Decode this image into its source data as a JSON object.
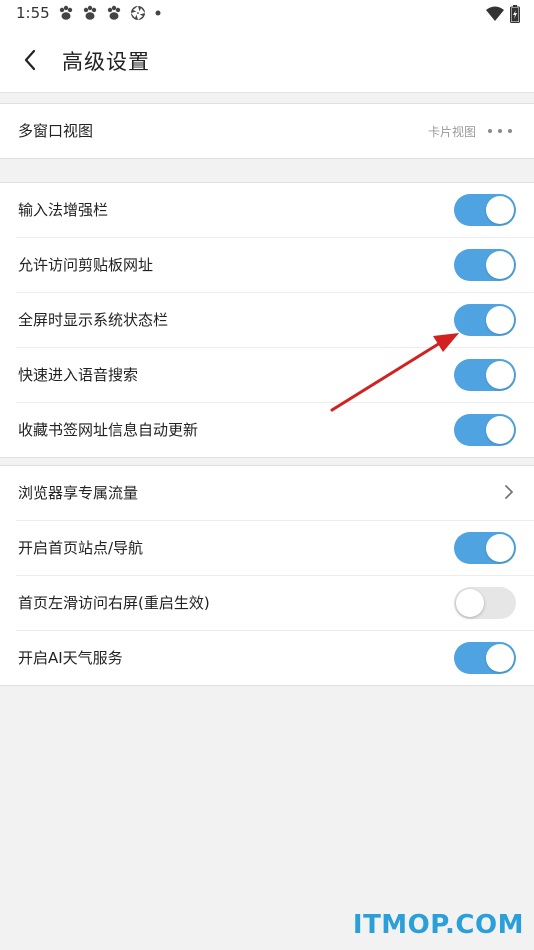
{
  "status_bar": {
    "time": "1:55",
    "icons": [
      "paw-icon",
      "paw-icon",
      "paw-icon",
      "aperture-icon",
      "dot-icon",
      "wifi-icon",
      "battery-icon"
    ]
  },
  "header": {
    "title": "高级设置"
  },
  "sections": [
    {
      "rows": [
        {
          "label": "多窗口视图",
          "value": "卡片视图",
          "control": "more"
        }
      ]
    },
    {
      "rows": [
        {
          "label": "输入法增强栏",
          "toggle": true
        },
        {
          "label": "允许访问剪贴板网址",
          "toggle": true
        },
        {
          "label": "全屏时显示系统状态栏",
          "toggle": true
        },
        {
          "label": "快速进入语音搜索",
          "toggle": true
        },
        {
          "label": "收藏书签网址信息自动更新",
          "toggle": true
        }
      ]
    },
    {
      "rows": [
        {
          "label": "浏览器享专属流量",
          "control": "chevron"
        },
        {
          "label": "开启首页站点/导航",
          "toggle": true
        },
        {
          "label": "首页左滑访问右屏(重启生效)",
          "toggle": false
        },
        {
          "label": "开启AI天气服务",
          "toggle": true
        }
      ]
    }
  ],
  "colors": {
    "toggle_on": "#4ea3e0",
    "toggle_off": "#e6e6e6",
    "arrow": "#d32020",
    "watermark": "#2a9fd8"
  },
  "watermark": "ITMOP.COM"
}
